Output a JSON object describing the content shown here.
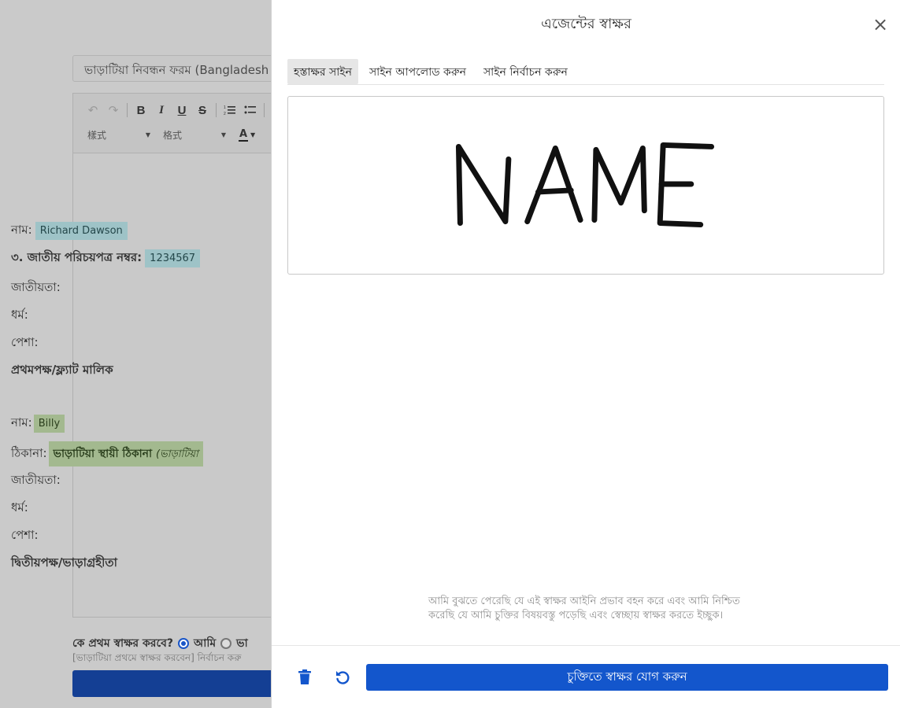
{
  "background": {
    "doc_title": "ভাড়াটিয়া নিবন্ধন ফরম (Bangladesh Police)",
    "toolbar": {
      "undo": "↶",
      "redo": "↷",
      "bold": "B",
      "italic": "I",
      "underline": "U",
      "strike": "S",
      "style_combo": "樣式",
      "format_combo": "格式",
      "font_color": "A"
    },
    "lines": {
      "name1_label": "নাম:",
      "name1_value": "Richard Dawson",
      "nid_label": "৩. জাতীয় পরিচয়পত্র নম্বর:",
      "nid_value": "1234567",
      "nationality1": "জাতীয়তা:",
      "religion1": "ধর্ম:",
      "profession1": "পেশা:",
      "first_party": "প্রথমপক্ষ/ফ্ল্যাট মালিক",
      "name2_label": "নাম:",
      "name2_value": "Billy",
      "address_label": "ঠিকানা:",
      "address_value": "ভাড়াটিয়া স্থায়ী ঠিকানা",
      "address_hint": "(ভাড়াটিয়া",
      "nationality2": "জাতীয়তা:",
      "religion2": "ধর্ম:",
      "profession2": "পেশা:",
      "second_party": "দ্বিতীয়পক্ষ/ভাড়াগ্রহীতা"
    },
    "who_signs_first": "কে প্রথম স্বাক্ষর করবে?",
    "option_me": "আমি",
    "option_other": "ভা",
    "hint": "[ভাড়াটিয়া প্রথমে স্বাক্ষর করবেন] নির্বাচন করু"
  },
  "modal": {
    "title": "এজেন্টের স্বাক্ষর",
    "tabs": [
      {
        "label": "হস্তাক্ষর সাইন",
        "active": true
      },
      {
        "label": "সাইন আপলোড করুন",
        "active": false
      },
      {
        "label": "সাইন নির্বাচন করুন",
        "active": false
      }
    ],
    "legal_text": "আমি বুঝতে পেরেছি যে এই স্বাক্ষর আইনি প্রভাব বহন করে এবং আমি নিশ্চিত করেছি যে আমি চুক্তির বিষয়বস্তু পড়েছি এবং স্বেচ্ছায় স্বাক্ষর করতে ইচ্ছুক।",
    "add_button": "চুক্তিতে স্বাক্ষর যোগ করুন",
    "accent_color": "#1356cc"
  }
}
